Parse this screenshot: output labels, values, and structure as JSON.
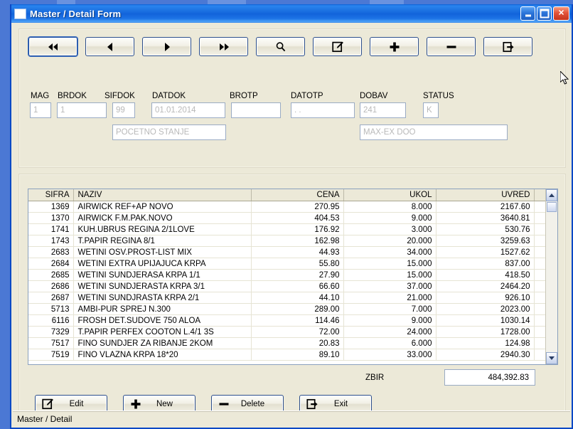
{
  "window": {
    "title": "Master / Detail Form",
    "icon": "window-icon",
    "controls": {
      "minimize": "minimize-button",
      "maximize": "maximize-button",
      "close": "close-button"
    }
  },
  "toolbar": {
    "buttons": [
      {
        "name": "first-record-button",
        "icon": "double-left-arrow-icon",
        "focused": true
      },
      {
        "name": "previous-record-button",
        "icon": "left-arrow-icon",
        "focused": false
      },
      {
        "name": "next-record-button",
        "icon": "right-arrow-icon",
        "focused": false
      },
      {
        "name": "last-record-button",
        "icon": "double-right-arrow-icon",
        "focused": false
      },
      {
        "name": "search-button",
        "icon": "magnifier-icon",
        "focused": false
      },
      {
        "name": "edit-button",
        "icon": "pencil-square-icon",
        "focused": false
      },
      {
        "name": "add-button",
        "icon": "plus-icon",
        "focused": false
      },
      {
        "name": "delete-button",
        "icon": "minus-icon",
        "focused": false
      },
      {
        "name": "exit-button",
        "icon": "exit-arrow-icon",
        "focused": false
      }
    ]
  },
  "form": {
    "fields": [
      {
        "label": "MAG",
        "value": "1"
      },
      {
        "label": "BRDOK",
        "value": "1"
      },
      {
        "label": "SIFDOK",
        "value": "99"
      },
      {
        "label": "DATDOK",
        "value": "01.01.2014"
      },
      {
        "label": "BROTP",
        "value": ""
      },
      {
        "label": "DATOTP",
        "value": ". ."
      },
      {
        "label": "DOBAV",
        "value": "241"
      },
      {
        "label": "STATUS",
        "value": "K"
      }
    ],
    "sifdok_description": "POCETNO STANJE",
    "dobav_description": "MAX-EX DOO"
  },
  "grid": {
    "columns": [
      "SIFRA",
      "NAZIV",
      "CENA",
      "UKOL",
      "UVRED"
    ],
    "rows": [
      {
        "sifra": "1369",
        "naziv": "AIRWICK REF+AP NOVO",
        "cena": "270.95",
        "ukol": "8.000",
        "uvred": "2167.60"
      },
      {
        "sifra": "1370",
        "naziv": "AIRWICK F.M.PAK.NOVO",
        "cena": "404.53",
        "ukol": "9.000",
        "uvred": "3640.81"
      },
      {
        "sifra": "1741",
        "naziv": "KUH.UBRUS REGINA 2/1LOVE",
        "cena": "176.92",
        "ukol": "3.000",
        "uvred": "530.76"
      },
      {
        "sifra": "1743",
        "naziv": "T.PAPIR REGINA 8/1",
        "cena": "162.98",
        "ukol": "20.000",
        "uvred": "3259.63"
      },
      {
        "sifra": "2683",
        "naziv": "WETINI OSV.PROST-LIST MIX",
        "cena": "44.93",
        "ukol": "34.000",
        "uvred": "1527.62"
      },
      {
        "sifra": "2684",
        "naziv": "WETINI EXTRA UPIJAJUCA KRPA",
        "cena": "55.80",
        "ukol": "15.000",
        "uvred": "837.00"
      },
      {
        "sifra": "2685",
        "naziv": "WETINI SUNDJERASA KRPA 1/1",
        "cena": "27.90",
        "ukol": "15.000",
        "uvred": "418.50"
      },
      {
        "sifra": "2686",
        "naziv": "WETINI SUNDJERASTA KRPA 3/1",
        "cena": "66.60",
        "ukol": "37.000",
        "uvred": "2464.20"
      },
      {
        "sifra": "2687",
        "naziv": "WETINI SUNDJRASTA KRPA 2/1",
        "cena": "44.10",
        "ukol": "21.000",
        "uvred": "926.10"
      },
      {
        "sifra": "5713",
        "naziv": "AMBI-PUR SPREJ N.300",
        "cena": "289.00",
        "ukol": "7.000",
        "uvred": "2023.00"
      },
      {
        "sifra": "6116",
        "naziv": "FROSH DET.SUDOVE 750 ALOA",
        "cena": "114.46",
        "ukol": "9.000",
        "uvred": "1030.14"
      },
      {
        "sifra": "7329",
        "naziv": "T.PAPIR PERFEX COOTON L.4/1 3S",
        "cena": "72.00",
        "ukol": "24.000",
        "uvred": "1728.00"
      },
      {
        "sifra": "7517",
        "naziv": "FINO SUNDJER ZA RIBANJE 2KOM",
        "cena": "20.83",
        "ukol": "6.000",
        "uvred": "124.98"
      },
      {
        "sifra": "7519",
        "naziv": "FINO VLAZNA KRPA 18*20",
        "cena": "89.10",
        "ukol": "33.000",
        "uvred": "2940.30"
      }
    ]
  },
  "total": {
    "label": "ZBIR",
    "value": "484,392.83"
  },
  "actions": [
    {
      "name": "edit-action-button",
      "label": "Edit",
      "icon": "pencil-square-icon"
    },
    {
      "name": "new-action-button",
      "label": "New",
      "icon": "plus-icon"
    },
    {
      "name": "delete-action-button",
      "label": "Delete",
      "icon": "minus-icon"
    },
    {
      "name": "exit-action-button",
      "label": "Exit",
      "icon": "exit-arrow-icon"
    }
  ],
  "statusbar": {
    "text": "Master / Detail"
  },
  "colors": {
    "title_blue": "#1263db",
    "face": "#ece9d8",
    "field_border": "#9aabc4",
    "button_border": "#2c4e8a",
    "close_red": "#c5341c"
  }
}
